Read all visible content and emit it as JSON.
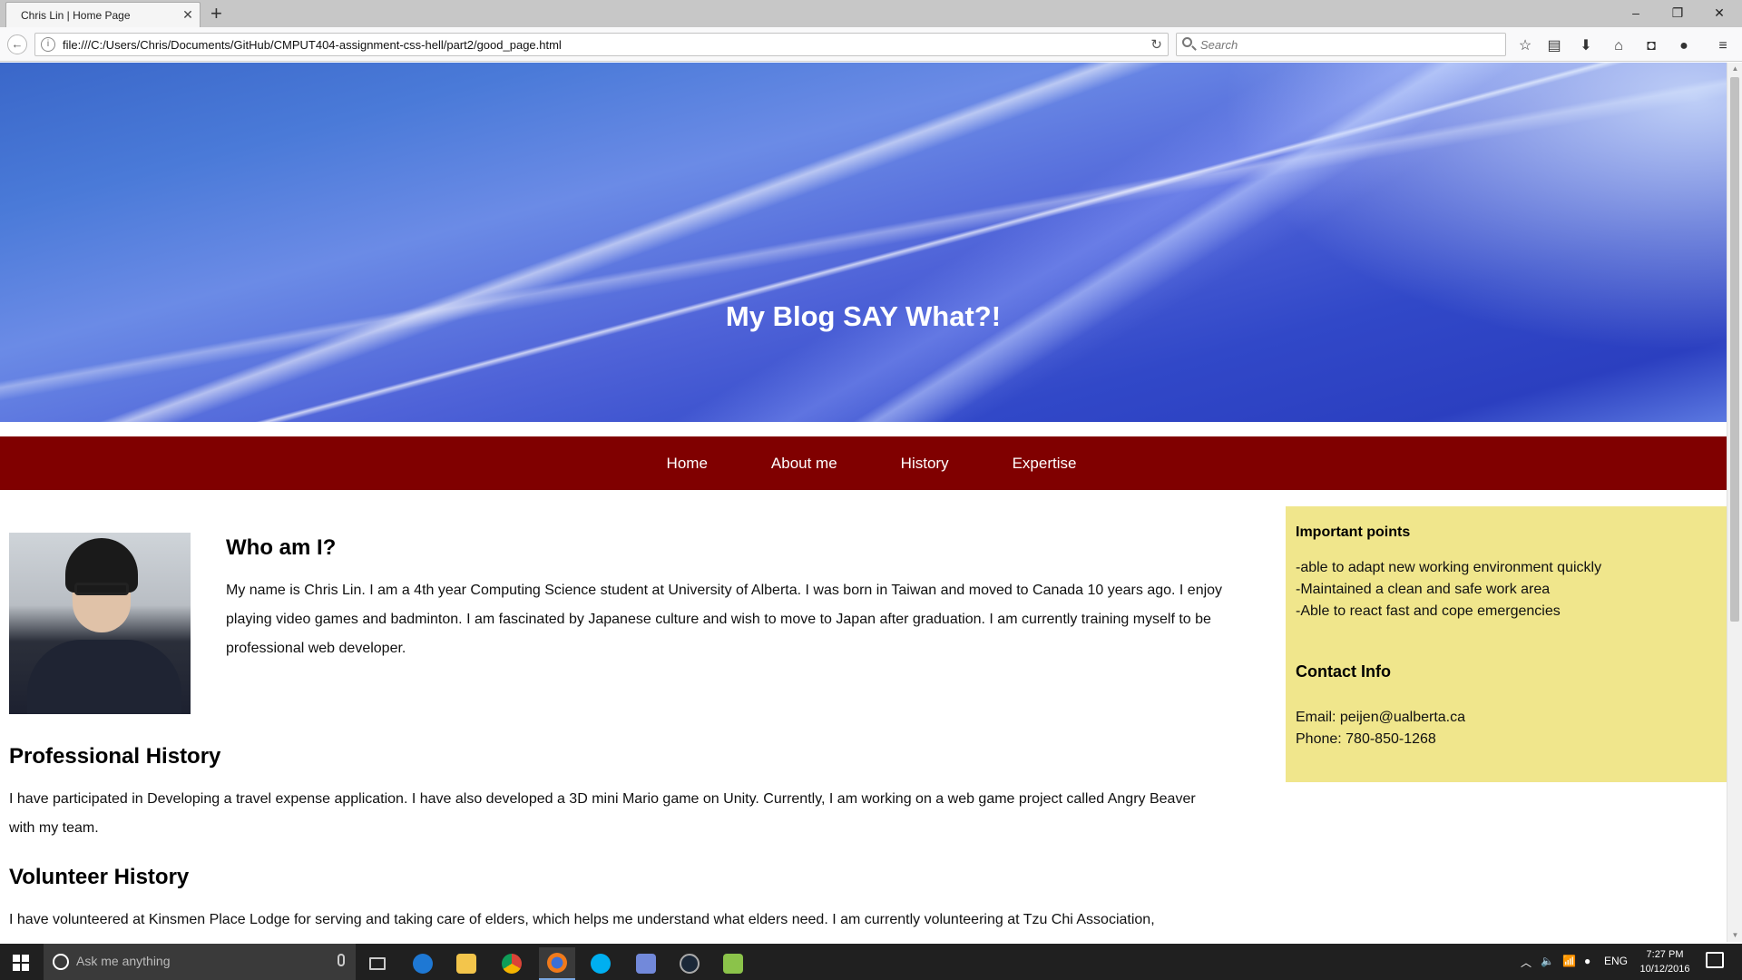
{
  "browser": {
    "tab_title": "Chris Lin | Home Page",
    "url": "file:///C:/Users/Chris/Documents/GitHub/CMPUT404-assignment-css-hell/part2/good_page.html",
    "search_placeholder": "Search"
  },
  "page": {
    "banner_title": "My Blog SAY What?!",
    "menu": [
      "Home",
      "About me",
      "History",
      "Expertise"
    ],
    "who": {
      "title": "Who am I?",
      "text": "My name is Chris Lin. I am a 4th year Computing Science student at University of Alberta. I was born in Taiwan and moved to Canada 10 years ago. I enjoy playing video games and badminton. I am fascinated by Japanese culture and wish to move to Japan after graduation. I am currently training myself to be professional web developer."
    },
    "professional": {
      "title": "Professional History",
      "text": "I have participated in Developing a travel expense application. I have also developed a 3D mini Mario game on Unity. Currently, I am working on a web game project called Angry Beaver with my team."
    },
    "volunteer": {
      "title": "Volunteer History",
      "text": "I have volunteered at Kinsmen Place Lodge for serving and taking care of elders, which helps me understand what elders need. I am currently volunteering at Tzu Chi Association,"
    },
    "sidebar": {
      "points_title": "Important points",
      "points": [
        "-able to adapt new working environment quickly",
        "-Maintained a clean and safe work area",
        "-Able to react fast and cope emergencies"
      ],
      "contact_title": "Contact Info",
      "email": "Email: peijen@ualberta.ca",
      "phone": "Phone: 780-850-1268"
    }
  },
  "taskbar": {
    "search_placeholder": "Ask me anything",
    "language": "ENG",
    "time": "7:27 PM",
    "date": "10/12/2016"
  },
  "colors": {
    "menu_bg": "#800000",
    "sidebar_bg": "#f0e68c"
  }
}
